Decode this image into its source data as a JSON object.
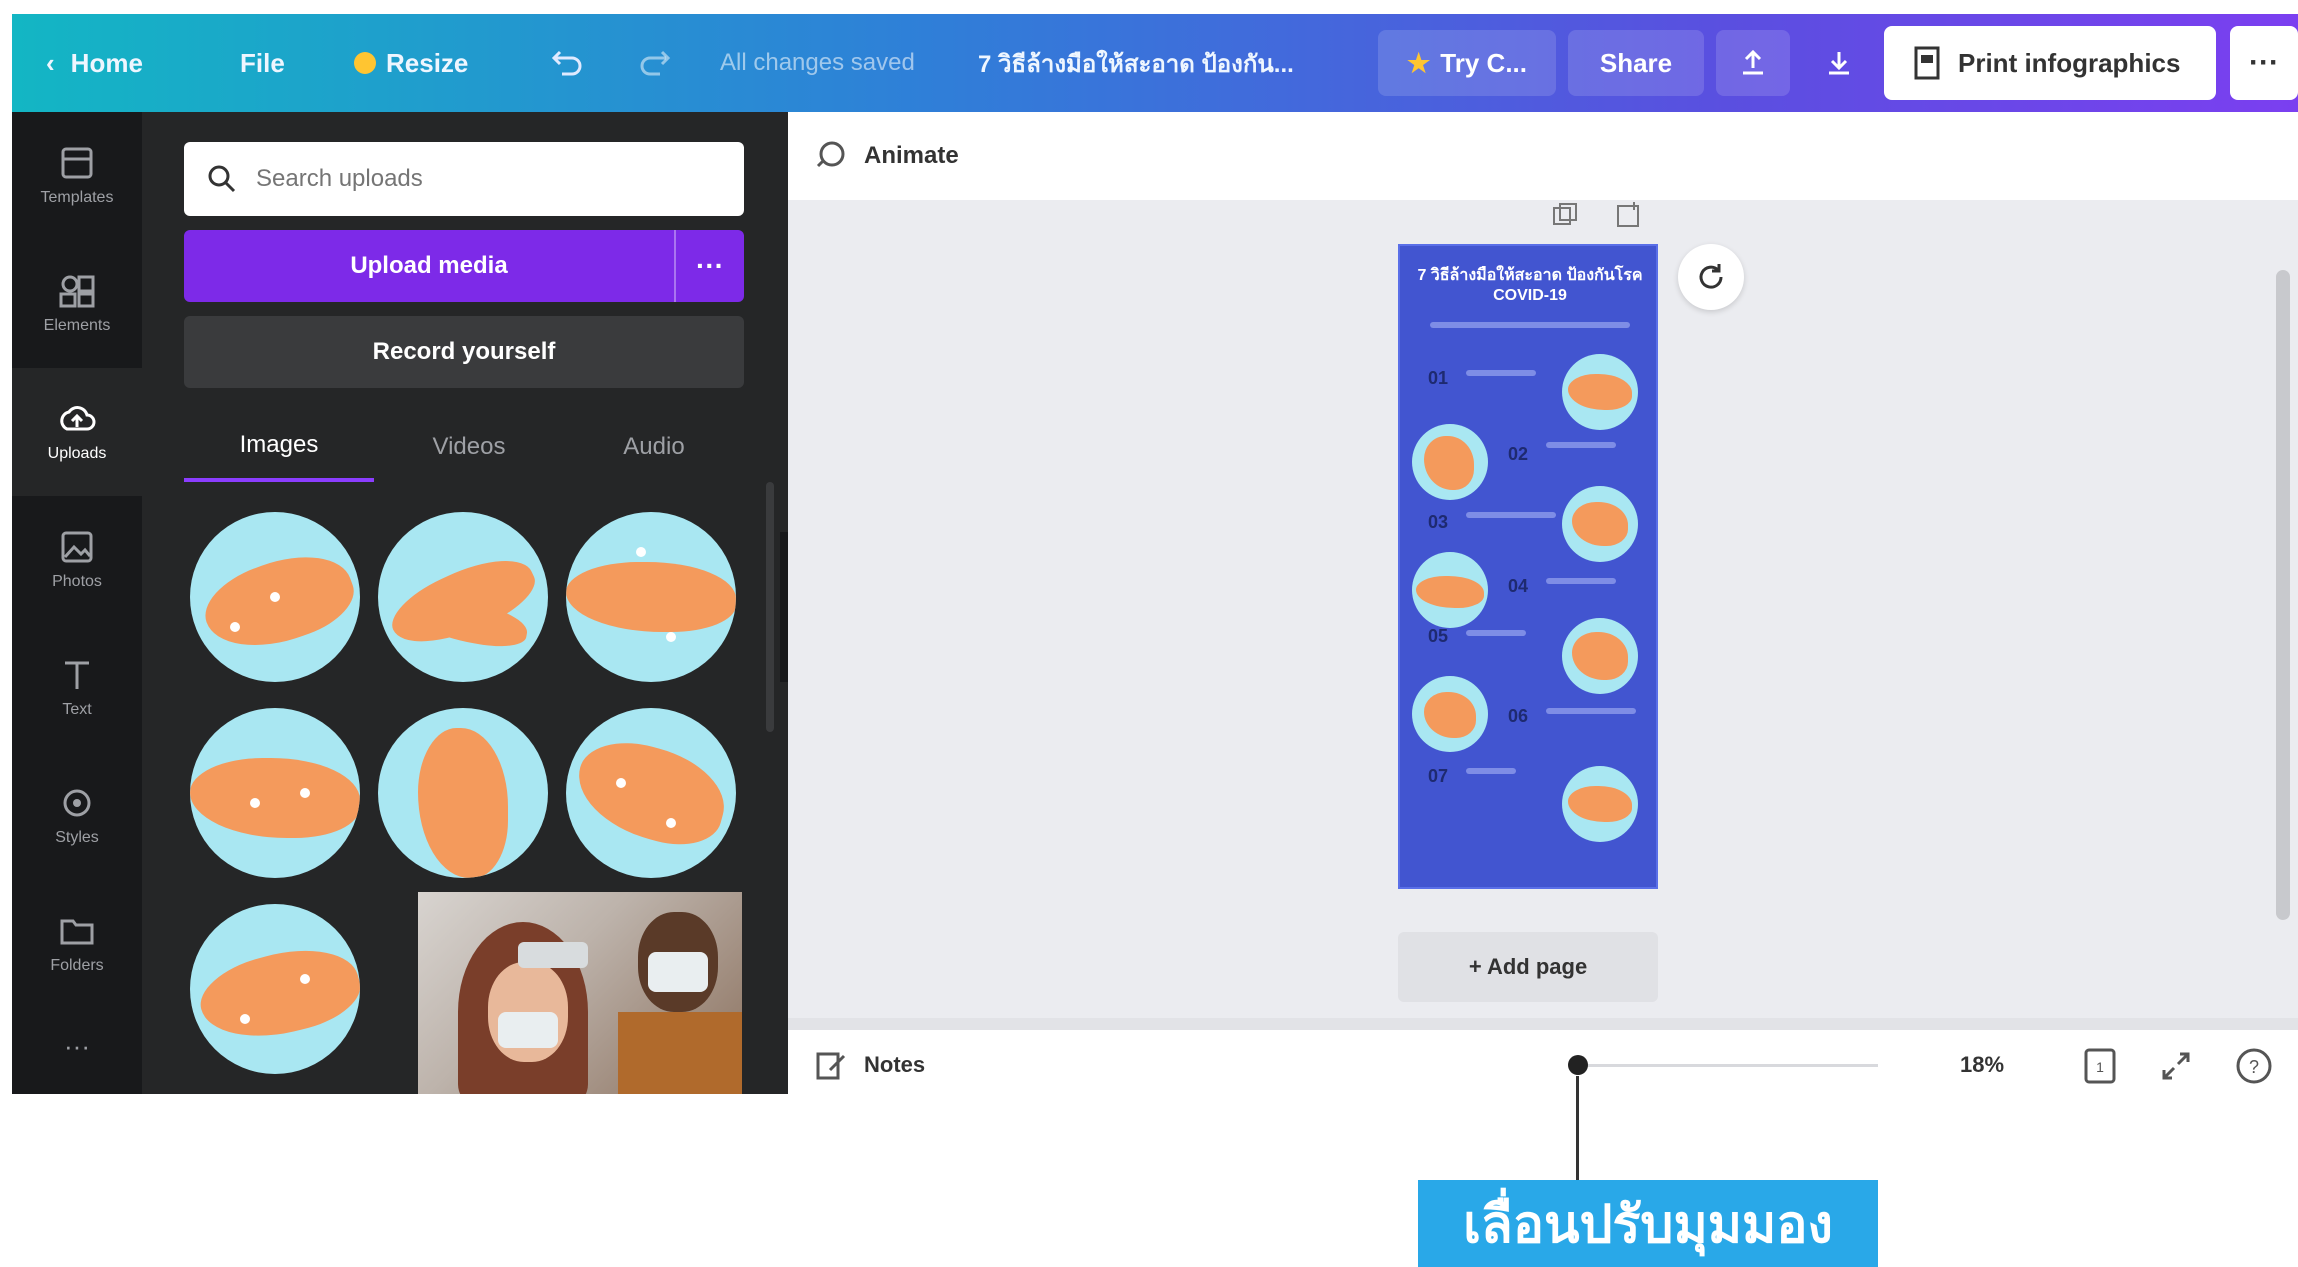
{
  "topbar": {
    "home": "Home",
    "file": "File",
    "resize": "Resize",
    "status": "All changes saved",
    "doc_title": "7 วิธีล้างมือให้สะอาด ป้องกัน...",
    "try": "Try C...",
    "share": "Share",
    "print": "Print infographics",
    "more": "···"
  },
  "rail": {
    "items": [
      {
        "label": "Templates",
        "icon": "templates-icon"
      },
      {
        "label": "Elements",
        "icon": "elements-icon"
      },
      {
        "label": "Uploads",
        "icon": "uploads-icon"
      },
      {
        "label": "Photos",
        "icon": "photos-icon"
      },
      {
        "label": "Text",
        "icon": "text-icon"
      },
      {
        "label": "Styles",
        "icon": "styles-icon"
      },
      {
        "label": "Folders",
        "icon": "folders-icon"
      },
      {
        "label": "···",
        "icon": "more-icon"
      }
    ]
  },
  "panel": {
    "search_placeholder": "Search uploads",
    "upload_label": "Upload media",
    "upload_more": "···",
    "record_label": "Record yourself",
    "tabs": [
      "Images",
      "Videos",
      "Audio"
    ]
  },
  "canvas": {
    "animate": "Animate",
    "page_title": "7 วิธีล้างมือให้สะอาด ป้องกันโรค COVID-19",
    "steps": [
      "01",
      "02",
      "03",
      "04",
      "05",
      "06",
      "07"
    ],
    "add_page": "+ Add page"
  },
  "bottombar": {
    "notes": "Notes",
    "zoom": "18%",
    "page_count": "1"
  },
  "callout": {
    "text": "เลื่อนปรับมุมมอง"
  },
  "colors": {
    "accent": "#7d2ae8",
    "page_bg": "#4255d0",
    "callout": "#29a8e8"
  }
}
